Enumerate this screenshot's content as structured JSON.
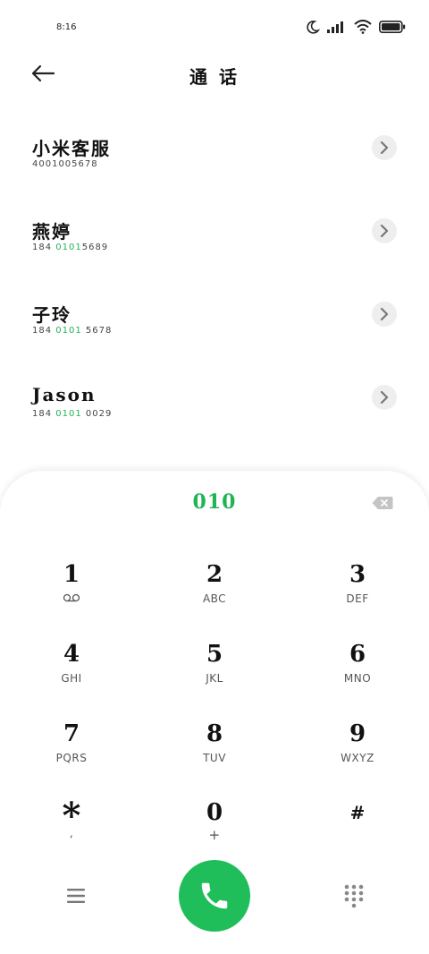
{
  "status_bar": {
    "time": "8:16"
  },
  "header": {
    "title": "通 话"
  },
  "contacts": [
    {
      "name": "小米客服",
      "number_pre": "40010056",
      "number_match": "",
      "number_post": "78"
    },
    {
      "name": "燕婷",
      "number_pre": "184 ",
      "number_match": "0101",
      "number_post": "5689"
    },
    {
      "name": "子玲",
      "number_pre": "184 ",
      "number_match": "0101",
      "number_post": " 5678"
    },
    {
      "name": "Jason",
      "number_pre": "184 ",
      "number_match": "0101",
      "number_post": " 0029"
    }
  ],
  "dialer": {
    "display": "010",
    "keys": [
      {
        "digit": "1",
        "letters": ""
      },
      {
        "digit": "2",
        "letters": "ABC"
      },
      {
        "digit": "3",
        "letters": "DEF"
      },
      {
        "digit": "4",
        "letters": "GHI"
      },
      {
        "digit": "5",
        "letters": "JKL"
      },
      {
        "digit": "6",
        "letters": "MNO"
      },
      {
        "digit": "7",
        "letters": "PQRS"
      },
      {
        "digit": "8",
        "letters": "TUV"
      },
      {
        "digit": "9",
        "letters": "WXYZ"
      },
      {
        "digit": "*",
        "letters": ","
      },
      {
        "digit": "0",
        "letters": "+"
      },
      {
        "digit": "#",
        "letters": ""
      }
    ]
  },
  "colors": {
    "accent": "#1fb455",
    "call_button": "#1fbe5a",
    "arrow_bg": "#eeeeee"
  },
  "icons": {
    "back": "arrow-left-icon",
    "arrow": "chevron-right-icon",
    "backspace": "backspace-icon",
    "voicemail": "voicemail-icon",
    "menu": "menu-icon",
    "call": "phone-icon",
    "keypad": "dialpad-icon"
  }
}
